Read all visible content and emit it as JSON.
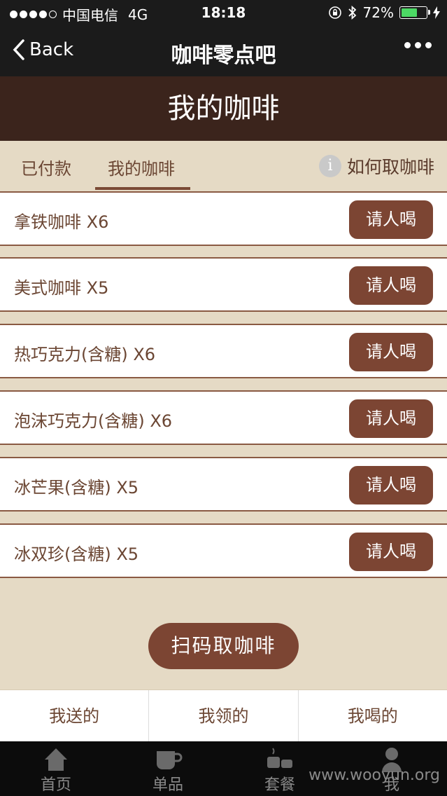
{
  "status_bar": {
    "carrier": "中国电信",
    "network": "4G",
    "time": "18:18",
    "battery": "72%",
    "battery_level": 0.72
  },
  "nav": {
    "back_label": "Back",
    "title": "咖啡零点吧"
  },
  "header": {
    "title": "我的咖啡"
  },
  "tabs": [
    {
      "label": "已付款"
    },
    {
      "label": "我的咖啡"
    }
  ],
  "howto_label": "如何取咖啡",
  "coffees": [
    {
      "name": "拿铁咖啡 X6",
      "action": "请人喝"
    },
    {
      "name": "美式咖啡 X5",
      "action": "请人喝"
    },
    {
      "name": "热巧克力(含糖) X6",
      "action": "请人喝"
    },
    {
      "name": "泡沫巧克力(含糖) X6",
      "action": "请人喝"
    },
    {
      "name": "冰芒果(含糖) X5",
      "action": "请人喝"
    },
    {
      "name": "冰双珍(含糖) X5",
      "action": "请人喝"
    }
  ],
  "scan_button": "扫码取咖啡",
  "sub_tabs": [
    {
      "label": "我送的"
    },
    {
      "label": "我领的"
    },
    {
      "label": "我喝的"
    }
  ],
  "bottom_nav": [
    {
      "label": "首页",
      "icon": "home-icon"
    },
    {
      "label": "单品",
      "icon": "cup-icon"
    },
    {
      "label": "套餐",
      "icon": "set-meal-icon"
    },
    {
      "label": "我",
      "icon": "user-icon"
    }
  ],
  "watermark": "www.wooyun.org",
  "colors": {
    "header_bg": "#3b241c",
    "button_bg": "#7c4533",
    "page_bg": "#e5dac5",
    "text_brown": "#6b4633"
  }
}
